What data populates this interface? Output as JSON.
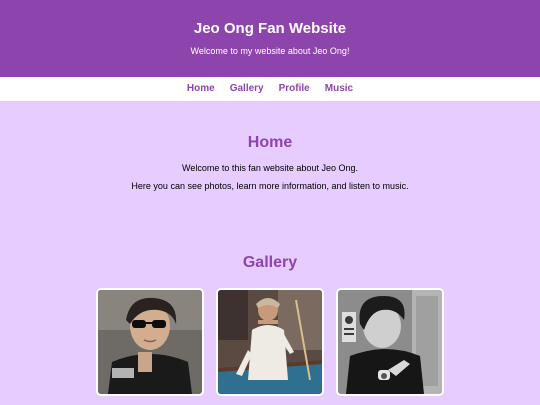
{
  "header": {
    "title": "Jeo Ong Fan Website",
    "tagline": "Welcome to my website about Jeo Ong!"
  },
  "nav": {
    "items": [
      {
        "label": "Home"
      },
      {
        "label": "Gallery"
      },
      {
        "label": "Profile"
      },
      {
        "label": "Music"
      }
    ]
  },
  "home": {
    "heading": "Home",
    "line1": "Welcome to this fan website about Jeo Ong.",
    "line2": "Here you can see photos, learn more information, and listen to music."
  },
  "gallery": {
    "heading": "Gallery",
    "photos": [
      {
        "subject": "man-in-sunglasses-photo"
      },
      {
        "subject": "man-at-pool-table-photo"
      },
      {
        "subject": "man-in-elevator-photo"
      }
    ]
  },
  "colors": {
    "accent": "#8e44ad",
    "background": "#e6ccff",
    "nav_background": "#ffffff"
  }
}
